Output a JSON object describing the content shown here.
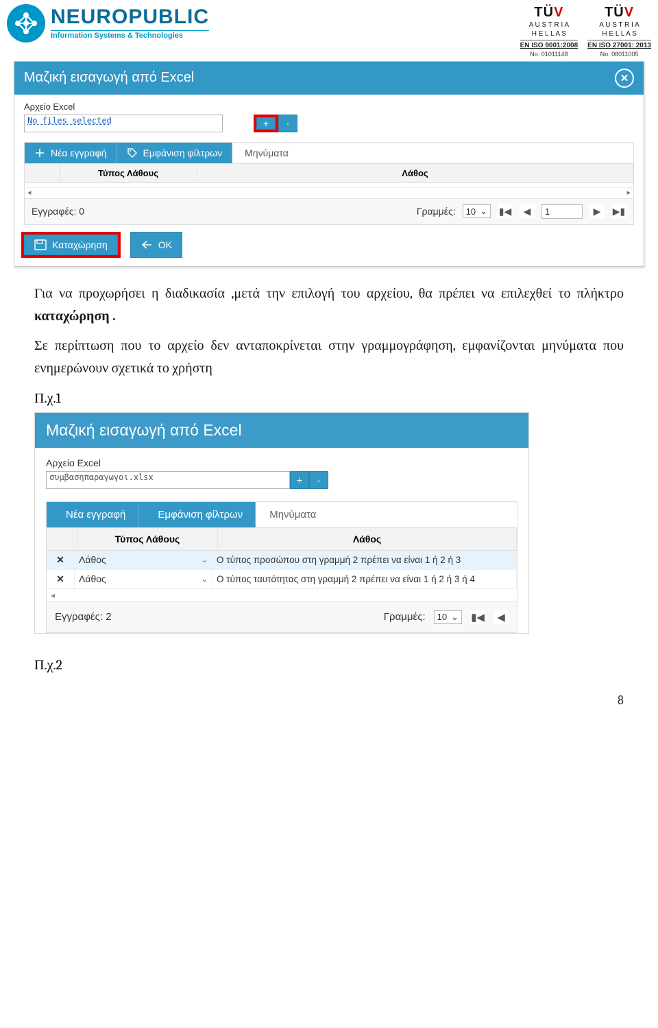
{
  "header": {
    "company_name": "NEUROPUBLIC",
    "company_tagline": "Information Systems & Technologies",
    "cert1": {
      "brand": "TÜV",
      "l1": "A U S T R I A",
      "l2": "H E L L A S",
      "iso": "EN ISO 9001:2008",
      "no": "No. 01011148"
    },
    "cert2": {
      "brand": "TÜV",
      "l1": "A U S T R I A",
      "l2": "H E L L A S",
      "iso": "EN ISO 27001: 2013",
      "no": "No. 08011005"
    }
  },
  "dlg1": {
    "title": "Μαζική εισαγωγή από Excel",
    "file_label": "Αρχείο Excel",
    "file_value": "No files selected",
    "plus": "+",
    "dots": "·",
    "tab_new": "Νέα εγγραφή",
    "tab_filters": "Εμφάνιση φίλτρων",
    "tab_msgs": "Μηνύματα",
    "col_type": "Τύπος Λάθους",
    "col_error": "Λάθος",
    "records_label": "Εγγραφές:",
    "records_val": "0",
    "lines_label": "Γραμμές:",
    "lines_val": "10",
    "page_val": "1",
    "btn_save": "Καταχώρηση",
    "btn_ok": "OK",
    "scroll_left": "◂",
    "scroll_right": "▸",
    "first": "▮◀",
    "prev": "◀",
    "next": "▶",
    "last": "▶▮"
  },
  "para1_a": "Για να προχωρήσει η διαδικασία ,μετά την επιλογή του αρχείου, θα πρέπει να επιλεχθεί το πλήκτρο ",
  "para1_b": "καταχώρηση .",
  "para2": "Σε περίπτωση που το αρχείο δεν ανταποκρίνεται στην γραμμογράφηση, εμφανίζονται μηνύματα που ενημερώνουν σχετικά το χρήστη",
  "eg1": "Π.χ.1",
  "eg2": "Π.χ.2",
  "dlg2": {
    "title": "Μαζική εισαγωγή από Excel",
    "file_label": "Αρχείο Excel",
    "file_value": "συμβασηπαραγωγοι.xlsx",
    "plus": "+",
    "minus": "-",
    "tab_new": "Νέα εγγραφή",
    "tab_filters": "Εμφάνιση φίλτρων",
    "tab_msgs": "Μηνύματα",
    "col_type": "Τύπος Λάθους",
    "col_error": "Λάθος",
    "row1_type": "Λάθος",
    "row1_err": "Ο τύπος προσώπου στη γραμμή 2 πρέπει να είναι 1 ή 2 ή 3",
    "row2_type": "Λάθος",
    "row2_err": "Ο τύπος ταυτότητας στη γραμμή 2 πρέπει να είναι 1 ή 2 ή 3  ή 4",
    "records_label": "Εγγραφές:",
    "records_val": "2",
    "lines_label": "Γραμμές:",
    "lines_val": "10",
    "first": "▮◀",
    "prev": "◀",
    "hs_left": "◂",
    "chev": "⌄"
  },
  "page_number": "8"
}
